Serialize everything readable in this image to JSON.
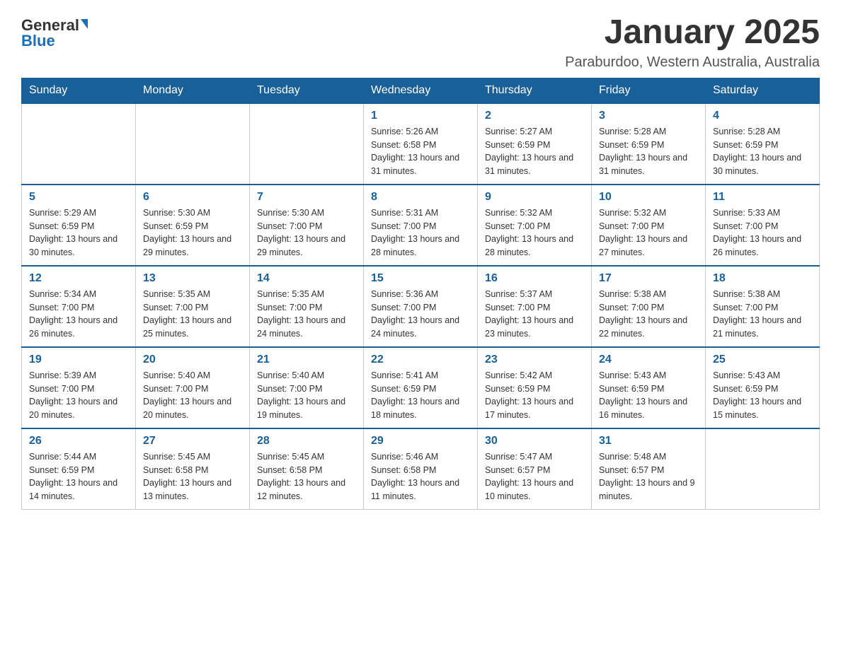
{
  "header": {
    "logo": {
      "text_general": "General",
      "text_blue": "Blue"
    },
    "title": "January 2025",
    "subtitle": "Paraburdoo, Western Australia, Australia"
  },
  "days_of_week": [
    "Sunday",
    "Monday",
    "Tuesday",
    "Wednesday",
    "Thursday",
    "Friday",
    "Saturday"
  ],
  "weeks": [
    [
      {
        "day": "",
        "info": ""
      },
      {
        "day": "",
        "info": ""
      },
      {
        "day": "",
        "info": ""
      },
      {
        "day": "1",
        "info": "Sunrise: 5:26 AM\nSunset: 6:58 PM\nDaylight: 13 hours and 31 minutes."
      },
      {
        "day": "2",
        "info": "Sunrise: 5:27 AM\nSunset: 6:59 PM\nDaylight: 13 hours and 31 minutes."
      },
      {
        "day": "3",
        "info": "Sunrise: 5:28 AM\nSunset: 6:59 PM\nDaylight: 13 hours and 31 minutes."
      },
      {
        "day": "4",
        "info": "Sunrise: 5:28 AM\nSunset: 6:59 PM\nDaylight: 13 hours and 30 minutes."
      }
    ],
    [
      {
        "day": "5",
        "info": "Sunrise: 5:29 AM\nSunset: 6:59 PM\nDaylight: 13 hours and 30 minutes."
      },
      {
        "day": "6",
        "info": "Sunrise: 5:30 AM\nSunset: 6:59 PM\nDaylight: 13 hours and 29 minutes."
      },
      {
        "day": "7",
        "info": "Sunrise: 5:30 AM\nSunset: 7:00 PM\nDaylight: 13 hours and 29 minutes."
      },
      {
        "day": "8",
        "info": "Sunrise: 5:31 AM\nSunset: 7:00 PM\nDaylight: 13 hours and 28 minutes."
      },
      {
        "day": "9",
        "info": "Sunrise: 5:32 AM\nSunset: 7:00 PM\nDaylight: 13 hours and 28 minutes."
      },
      {
        "day": "10",
        "info": "Sunrise: 5:32 AM\nSunset: 7:00 PM\nDaylight: 13 hours and 27 minutes."
      },
      {
        "day": "11",
        "info": "Sunrise: 5:33 AM\nSunset: 7:00 PM\nDaylight: 13 hours and 26 minutes."
      }
    ],
    [
      {
        "day": "12",
        "info": "Sunrise: 5:34 AM\nSunset: 7:00 PM\nDaylight: 13 hours and 26 minutes."
      },
      {
        "day": "13",
        "info": "Sunrise: 5:35 AM\nSunset: 7:00 PM\nDaylight: 13 hours and 25 minutes."
      },
      {
        "day": "14",
        "info": "Sunrise: 5:35 AM\nSunset: 7:00 PM\nDaylight: 13 hours and 24 minutes."
      },
      {
        "day": "15",
        "info": "Sunrise: 5:36 AM\nSunset: 7:00 PM\nDaylight: 13 hours and 24 minutes."
      },
      {
        "day": "16",
        "info": "Sunrise: 5:37 AM\nSunset: 7:00 PM\nDaylight: 13 hours and 23 minutes."
      },
      {
        "day": "17",
        "info": "Sunrise: 5:38 AM\nSunset: 7:00 PM\nDaylight: 13 hours and 22 minutes."
      },
      {
        "day": "18",
        "info": "Sunrise: 5:38 AM\nSunset: 7:00 PM\nDaylight: 13 hours and 21 minutes."
      }
    ],
    [
      {
        "day": "19",
        "info": "Sunrise: 5:39 AM\nSunset: 7:00 PM\nDaylight: 13 hours and 20 minutes."
      },
      {
        "day": "20",
        "info": "Sunrise: 5:40 AM\nSunset: 7:00 PM\nDaylight: 13 hours and 20 minutes."
      },
      {
        "day": "21",
        "info": "Sunrise: 5:40 AM\nSunset: 7:00 PM\nDaylight: 13 hours and 19 minutes."
      },
      {
        "day": "22",
        "info": "Sunrise: 5:41 AM\nSunset: 6:59 PM\nDaylight: 13 hours and 18 minutes."
      },
      {
        "day": "23",
        "info": "Sunrise: 5:42 AM\nSunset: 6:59 PM\nDaylight: 13 hours and 17 minutes."
      },
      {
        "day": "24",
        "info": "Sunrise: 5:43 AM\nSunset: 6:59 PM\nDaylight: 13 hours and 16 minutes."
      },
      {
        "day": "25",
        "info": "Sunrise: 5:43 AM\nSunset: 6:59 PM\nDaylight: 13 hours and 15 minutes."
      }
    ],
    [
      {
        "day": "26",
        "info": "Sunrise: 5:44 AM\nSunset: 6:59 PM\nDaylight: 13 hours and 14 minutes."
      },
      {
        "day": "27",
        "info": "Sunrise: 5:45 AM\nSunset: 6:58 PM\nDaylight: 13 hours and 13 minutes."
      },
      {
        "day": "28",
        "info": "Sunrise: 5:45 AM\nSunset: 6:58 PM\nDaylight: 13 hours and 12 minutes."
      },
      {
        "day": "29",
        "info": "Sunrise: 5:46 AM\nSunset: 6:58 PM\nDaylight: 13 hours and 11 minutes."
      },
      {
        "day": "30",
        "info": "Sunrise: 5:47 AM\nSunset: 6:57 PM\nDaylight: 13 hours and 10 minutes."
      },
      {
        "day": "31",
        "info": "Sunrise: 5:48 AM\nSunset: 6:57 PM\nDaylight: 13 hours and 9 minutes."
      },
      {
        "day": "",
        "info": ""
      }
    ]
  ]
}
